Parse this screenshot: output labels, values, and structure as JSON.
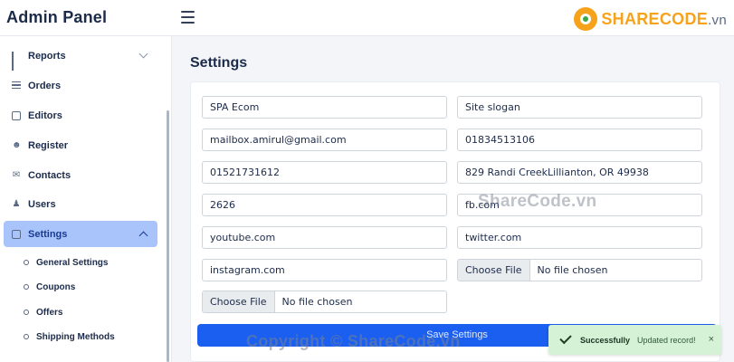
{
  "header": {
    "brand": "Admin Panel",
    "logo": {
      "name": "SHARECODE",
      "tld": ".vn"
    }
  },
  "sidebar": {
    "items": [
      {
        "label": "Reports",
        "icon": "bar-chart-icon"
      },
      {
        "label": "Orders",
        "icon": "list-icon"
      },
      {
        "label": "Editors",
        "icon": "edit-icon"
      },
      {
        "label": "Register",
        "icon": "user-icon"
      },
      {
        "label": "Contacts",
        "icon": "mail-icon"
      },
      {
        "label": "Users",
        "icon": "users-icon"
      },
      {
        "label": "Settings",
        "icon": "document-icon"
      }
    ],
    "settings_sub": [
      {
        "label": "General Settings"
      },
      {
        "label": "Coupons"
      },
      {
        "label": "Offers"
      },
      {
        "label": "Shipping Methods"
      }
    ]
  },
  "main": {
    "title": "Settings",
    "fields": {
      "site_name": "SPA Ecom",
      "site_slogan": "Site slogan",
      "email": "mailbox.amirul@gmail.com",
      "phone": "01834513106",
      "phone2": "01521731612",
      "address": "829 Randi CreekLillianton, OR 49938",
      "zip": "2626",
      "facebook": "fb.com",
      "youtube": "youtube.com",
      "twitter": "twitter.com",
      "instagram": "instagram.com"
    },
    "file_inputs": [
      {
        "button": "Choose File",
        "status": "No file chosen"
      },
      {
        "button": "Choose File",
        "status": "No file chosen"
      }
    ],
    "save_label": "Save Settings"
  },
  "watermarks": {
    "center": "ShareCode.vn",
    "footer": "Copyright © ShareCode.vn"
  },
  "toast": {
    "title": "Successfully",
    "message": "Updated record!",
    "close": "×"
  },
  "colors": {
    "primary": "#1a5ff0",
    "active_nav": "#a9c4fb",
    "toast_bg": "#d5f2d6",
    "brand_text": "#1c2b4a"
  }
}
